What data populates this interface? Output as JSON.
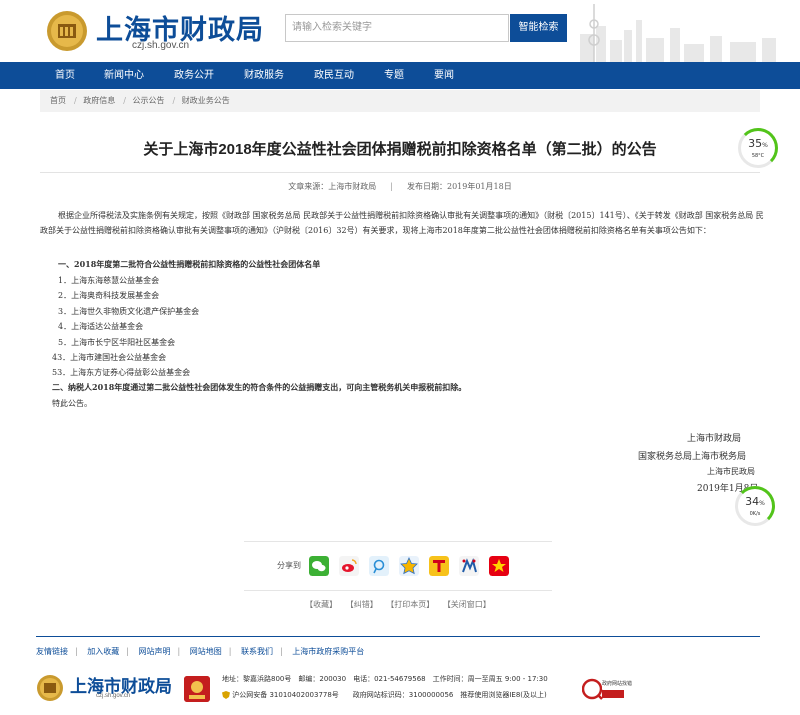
{
  "header": {
    "site_title": "上海市财政局",
    "site_domain": "czj.sh.gov.cn",
    "search_placeholder": "请输入检索关键字",
    "search_button": "智能检索"
  },
  "nav": [
    "首页",
    "新闻中心",
    "政务公开",
    "财政服务",
    "政民互动",
    "专题",
    "要闻"
  ],
  "breadcrumb": [
    "首页",
    "政府信息",
    "公示公告",
    "财政业务公告"
  ],
  "article": {
    "title": "关于上海市2018年度公益性社会团体捐赠税前扣除资格名单（第二批）的公告",
    "source_label": "文章来源：上海市财政局",
    "date_label": "发布日期：2019年01月18日",
    "para1": "根据企业所得税法及实施条例有关规定，按照《财政部 国家税务总局 民政部关于公益性捐赠税前扣除资格确认审批有关调整事项的通知》（财税〔2015〕141号）、《关于转发《财政部 国家税务总局 民政部关于公益性捐赠税前扣除资格确认审批有关调整事项的通知》（沪财税〔2016〕32号）有关要求，现将上海市2018年度第二批公益性社会团体捐赠税前扣除资格名单有关事项公告如下：",
    "section1": "一、2018年度第二批符合公益性捐赠税前扣除资格的公益性社会团体名单",
    "items": [
      "1．上海东海慈慧公益基金会",
      "2．上海奥奇科技发展基金会",
      "3．上海世久非物质文化遗产保护基金会",
      "4．上海适达公益基金会",
      "5．上海市长宁区华阳社区基金会",
      "43．上海市建国社会公益基金会",
      "53．上海东方证券心得益彰公益基金会"
    ],
    "section2": "二、纳税人2018年度通过第二批公益性社会团体发生的符合条件的公益捐赠支出，可向主管税务机关申报税前扣除。",
    "closing": "特此公告。",
    "sign1": "上海市财政局",
    "sign2": "国家税务总局上海市税务局",
    "sign3": "上海市民政局",
    "sign_date": "2019年1月8日"
  },
  "widgets": {
    "w1_pct": "35",
    "w1_unit": "%",
    "w1_sub": "58°C",
    "w2_pct": "34",
    "w2_unit": "%",
    "w2_sub": "0K/s"
  },
  "share": {
    "label": "分享到",
    "icons": [
      "wechat-icon",
      "weibo-icon",
      "tencent-weibo-icon",
      "qzone-icon",
      "tianya-icon",
      "renren-icon",
      "kaixin-icon"
    ]
  },
  "actions": [
    "【收藏】",
    "【纠错】",
    "【打印本页】",
    "【关闭窗口】"
  ],
  "footer": {
    "links": [
      "友情链接",
      "加入收藏",
      "网站声明",
      "网站地图",
      "联系我们",
      "上海市政府采购平台"
    ],
    "logo_title": "上海市财政局",
    "logo_sub": "czj.sh.gov.cn",
    "info1": "地址：黎嘉浜路800号　邮编：200030　电话：021-54679568　工作时间：周一至周五 9:00 - 17:30",
    "info2": "沪公网安备 31010402003778号　　政府网站标识码：3100000056　推荐使用浏览器IE8(及以上)",
    "gov_badge": "政府网站找错"
  },
  "colors": {
    "brand_blue": "#0d4d98",
    "gauge_green": "#52c41a"
  }
}
